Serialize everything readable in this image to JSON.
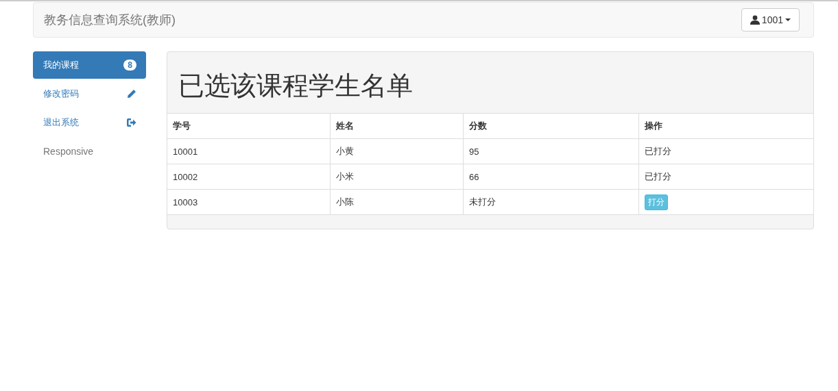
{
  "navbar": {
    "brand": "教务信息查询系统(教师)",
    "user_button": "1001"
  },
  "sidebar": {
    "items": [
      {
        "label": "我的课程",
        "kind": "badge",
        "badge": "8",
        "selected": true
      },
      {
        "label": "修改密码",
        "kind": "edit",
        "selected": false
      },
      {
        "label": "退出系统",
        "kind": "logout",
        "selected": false
      },
      {
        "label": "Responsive",
        "kind": "plain",
        "selected": false
      }
    ]
  },
  "panel": {
    "title": "已选该课程学生名单",
    "table": {
      "columns": [
        "学号",
        "姓名",
        "分数",
        "操作"
      ],
      "rows": [
        {
          "cells": [
            "10001",
            "小黄",
            "95"
          ],
          "action": {
            "kind": "text",
            "label": "已打分"
          }
        },
        {
          "cells": [
            "10002",
            "小米",
            "66"
          ],
          "action": {
            "kind": "text",
            "label": "已打分"
          }
        },
        {
          "cells": [
            "10003",
            "小陈",
            "未打分"
          ],
          "action": {
            "kind": "button",
            "label": "打分"
          }
        }
      ]
    }
  }
}
